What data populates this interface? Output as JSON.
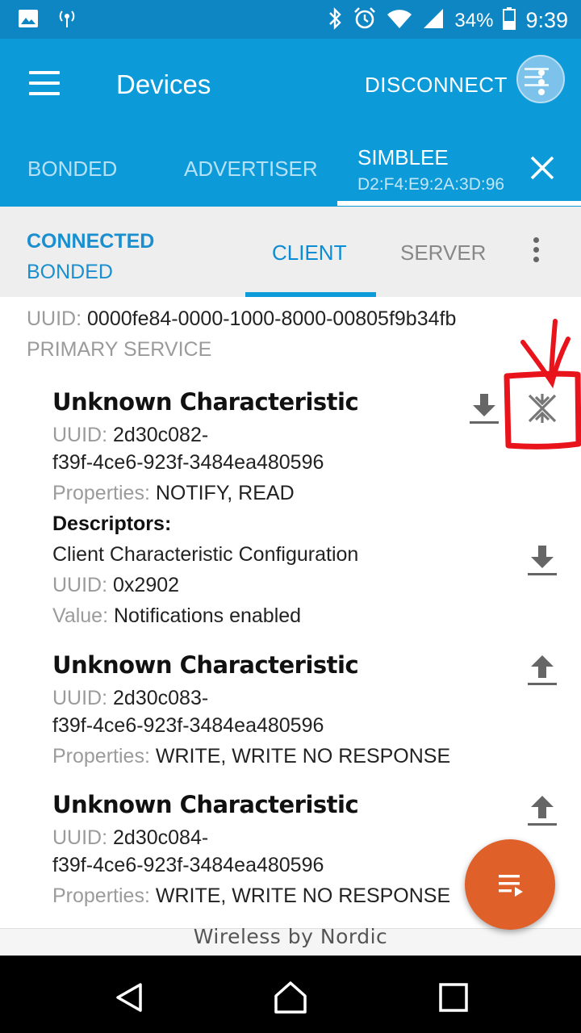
{
  "status_bar": {
    "battery": "34%",
    "time": "9:39",
    "icons": [
      "image-icon",
      "hotspot-icon",
      "bluetooth-icon",
      "alarm-icon",
      "wifi-icon",
      "signal-icon",
      "battery-icon"
    ]
  },
  "app_bar": {
    "title": "Devices",
    "disconnect_label": "DISCONNECT",
    "tabs": {
      "bonded": "BONDED",
      "advertiser": "ADVERTISER",
      "device_name": "SIMBLEE",
      "device_address": "D2:F4:E9:2A:3D:96"
    }
  },
  "sub_bar": {
    "state_connected": "CONNECTED",
    "state_bonded": "BONDED",
    "tab_client": "CLIENT",
    "tab_server": "SERVER"
  },
  "service": {
    "uuid_label": "UUID:",
    "uuid": "0000fe84-0000-1000-8000-00805f9b34fb",
    "type": "PRIMARY SERVICE"
  },
  "characteristics": [
    {
      "name": "Unknown Characteristic",
      "uuid_label": "UUID:",
      "uuid_line1": "2d30c082-",
      "uuid_line2": "f39f-4ce6-923f-3484ea480596",
      "props_label": "Properties:",
      "props": "NOTIFY, READ",
      "descriptors_label": "Descriptors:",
      "descriptor_name": "Client Characteristic Configuration",
      "descriptor_uuid_label": "UUID:",
      "descriptor_uuid": "0x2902",
      "value_label": "Value:",
      "value": "Notifications enabled"
    },
    {
      "name": "Unknown Characteristic",
      "uuid_label": "UUID:",
      "uuid_line1": "2d30c083-",
      "uuid_line2": "f39f-4ce6-923f-3484ea480596",
      "props_label": "Properties:",
      "props": "WRITE, WRITE NO RESPONSE"
    },
    {
      "name": "Unknown Characteristic",
      "uuid_label": "UUID:",
      "uuid_line1": "2d30c084-",
      "uuid_line2": "f39f-4ce6-923f-3484ea480596",
      "props_label": "Properties:",
      "props": "WRITE, WRITE NO RESPONSE"
    }
  ],
  "footer": {
    "text": "Wireless by Nordic"
  },
  "colors": {
    "status_bar": "#0f86c4",
    "app_bar": "#0c9ad9",
    "accent": "#0c8cd2",
    "fab": "#e0602a",
    "annotation": "#e8131b"
  }
}
